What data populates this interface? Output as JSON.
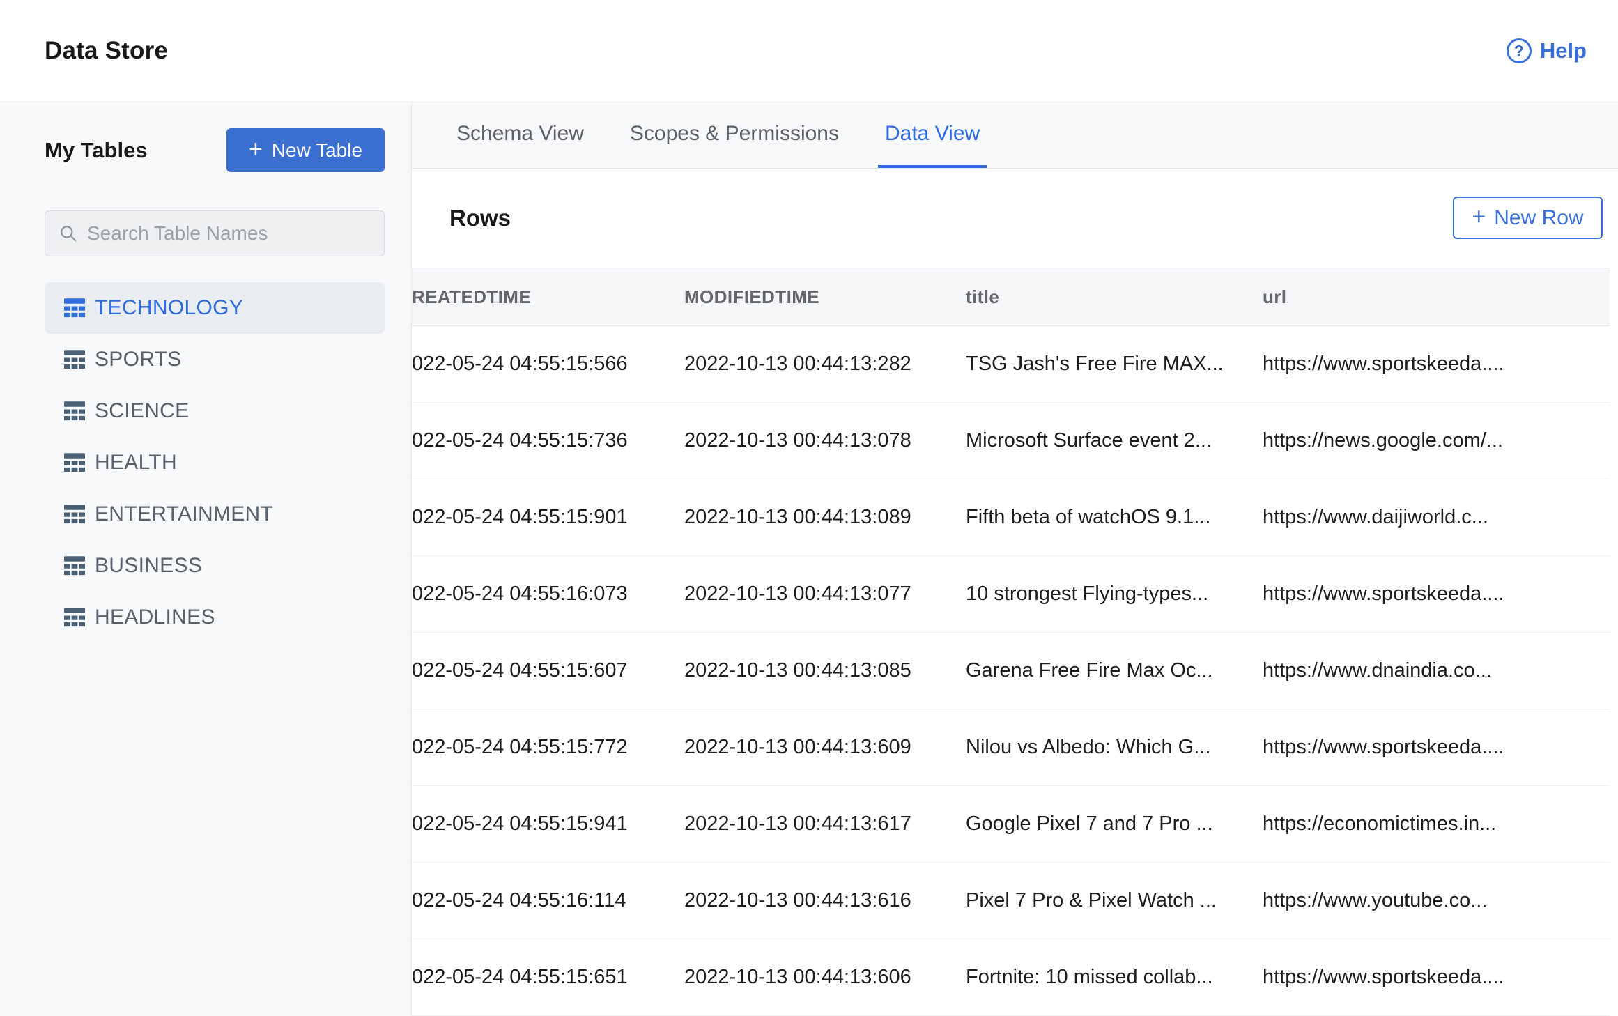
{
  "header": {
    "title": "Data Store",
    "help_label": "Help"
  },
  "sidebar": {
    "heading": "My Tables",
    "new_table_label": "New Table",
    "search_placeholder": "Search Table Names",
    "tables": [
      {
        "name": "TECHNOLOGY",
        "selected": true
      },
      {
        "name": "SPORTS",
        "selected": false
      },
      {
        "name": "SCIENCE",
        "selected": false
      },
      {
        "name": "HEALTH",
        "selected": false
      },
      {
        "name": "ENTERTAINMENT",
        "selected": false
      },
      {
        "name": "BUSINESS",
        "selected": false
      },
      {
        "name": "HEADLINES",
        "selected": false
      }
    ]
  },
  "tabs": [
    {
      "label": "Schema View",
      "active": false
    },
    {
      "label": "Scopes & Permissions",
      "active": false
    },
    {
      "label": "Data View",
      "active": true
    }
  ],
  "content": {
    "rows_heading": "Rows",
    "new_row_label": "New Row",
    "table": {
      "columns": [
        "REATEDTIME",
        "MODIFIEDTIME",
        "title",
        "url"
      ],
      "rows": [
        [
          "022-05-24 04:55:15:566",
          "2022-10-13 00:44:13:282",
          "TSG Jash's Free Fire MAX...",
          "https://www.sportskeeda...."
        ],
        [
          "022-05-24 04:55:15:736",
          "2022-10-13 00:44:13:078",
          "Microsoft Surface event 2...",
          "https://news.google.com/..."
        ],
        [
          "022-05-24 04:55:15:901",
          "2022-10-13 00:44:13:089",
          "Fifth beta of watchOS 9.1...",
          "https://www.daijiworld.c..."
        ],
        [
          "022-05-24 04:55:16:073",
          "2022-10-13 00:44:13:077",
          "10 strongest Flying-types...",
          "https://www.sportskeeda...."
        ],
        [
          "022-05-24 04:55:15:607",
          "2022-10-13 00:44:13:085",
          "Garena Free Fire Max Oc...",
          "https://www.dnaindia.co..."
        ],
        [
          "022-05-24 04:55:15:772",
          "2022-10-13 00:44:13:609",
          "Nilou vs Albedo: Which G...",
          "https://www.sportskeeda...."
        ],
        [
          "022-05-24 04:55:15:941",
          "2022-10-13 00:44:13:617",
          "Google Pixel 7 and 7 Pro ...",
          "https://economictimes.in..."
        ],
        [
          "022-05-24 04:55:16:114",
          "2022-10-13 00:44:13:616",
          "Pixel 7 Pro & Pixel Watch ...",
          "https://www.youtube.co..."
        ],
        [
          "022-05-24 04:55:15:651",
          "2022-10-13 00:44:13:606",
          "Fortnite: 10 missed collab...",
          "https://www.sportskeeda...."
        ]
      ]
    }
  },
  "colors": {
    "accent_blue": "#3a6fd0",
    "link_blue": "#2e6ce0",
    "selected_item_bg": "#e9edf2",
    "sidebar_bg": "#f8f9fa",
    "table_header_bg": "#f5f6f8"
  }
}
